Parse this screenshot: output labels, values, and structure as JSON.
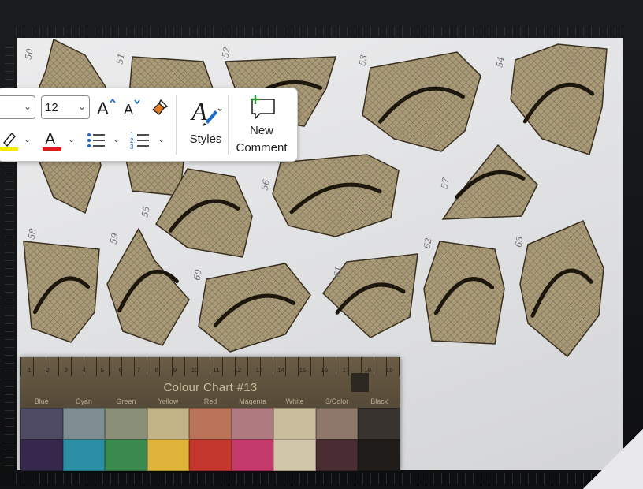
{
  "toolbar": {
    "font_name": "",
    "font_size": "12",
    "styles_label": "Styles",
    "new_comment_label_line1": "New",
    "new_comment_label_line2": "Comment",
    "colors": {
      "highlight": "#f5e900",
      "font_color": "#e01818",
      "accent_blue": "#1a6ac8",
      "new_comment_plus": "#2e9b3a",
      "brush_orange": "#e07b24"
    },
    "icons": {
      "grow_font": "A^",
      "shrink_font": "A˅",
      "format_painter": "brush-icon",
      "styles": "styles-icon",
      "highlight": "highlighter-icon",
      "font_color": "font-color-icon",
      "bullets": "bullet-list-icon",
      "numbering": "numbered-list-icon",
      "new_comment": "new-comment-icon"
    }
  },
  "photo": {
    "fragment_numbers": [
      "50",
      "51",
      "52",
      "53",
      "54",
      "55",
      "56",
      "57",
      "58",
      "59",
      "60",
      "61",
      "62",
      "63"
    ],
    "colour_chart": {
      "title": "Colour Chart #13",
      "ruler_numbers": [
        "1",
        "2",
        "3",
        "4",
        "5",
        "6",
        "7",
        "8",
        "9",
        "10",
        "11",
        "12",
        "13",
        "14",
        "15",
        "16",
        "17",
        "18",
        "19"
      ],
      "swatch_labels": [
        "Blue",
        "Cyan",
        "Green",
        "Yellow",
        "Red",
        "Magenta",
        "White",
        "3/Color",
        "Black"
      ],
      "swatch_colors_top": [
        "#4e4a63",
        "#7e8d92",
        "#8a9077",
        "#c2b487",
        "#b87358",
        "#b07b80",
        "#cabd9d",
        "#8d7869",
        "#3a3430"
      ],
      "swatch_colors_bottom": [
        "#35284c",
        "#2c8ea4",
        "#3a8a4e",
        "#e0b43a",
        "#c3372c",
        "#c43a6a",
        "#d2c6a9",
        "#4a2c33",
        "#201c1a"
      ]
    }
  }
}
